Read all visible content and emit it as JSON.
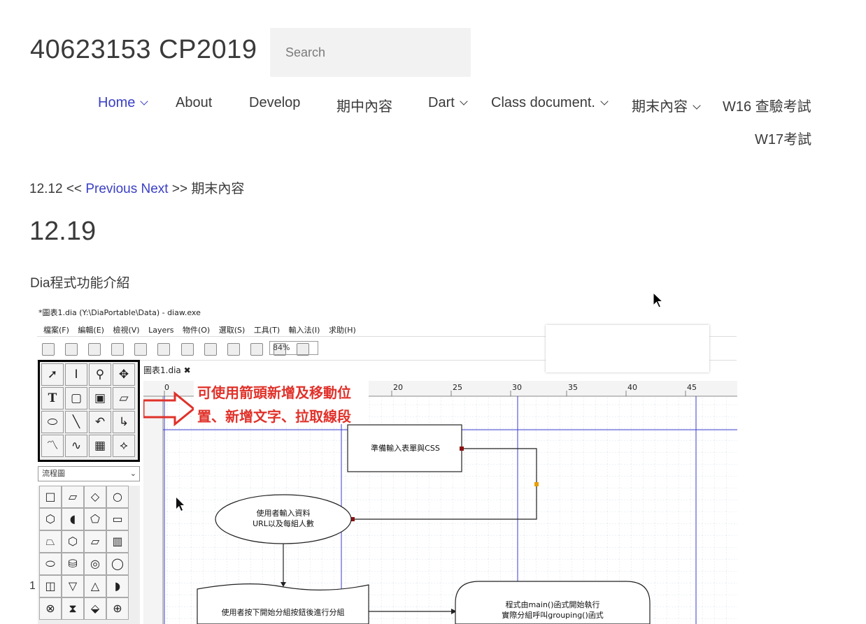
{
  "header": {
    "site_title": "40623153 CP2019",
    "search_placeholder": "Search"
  },
  "nav": [
    {
      "label": "Home",
      "dropdown": true,
      "active": true
    },
    {
      "label": "About",
      "dropdown": false
    },
    {
      "label": "Develop",
      "dropdown": false
    },
    {
      "label": "期中內容",
      "dropdown": false
    },
    {
      "label": "Dart",
      "dropdown": true
    },
    {
      "label": "Class document.",
      "dropdown": true
    },
    {
      "label": "期末內容",
      "dropdown": true
    },
    {
      "label": "W16 查驗考試",
      "dropdown": false
    },
    {
      "label": "W17考試",
      "dropdown": false
    }
  ],
  "breadcrumb": {
    "prefix": "12.12 <<",
    "previous": "Previous",
    "next": "Next",
    "suffix": ">> 期末內容"
  },
  "post": {
    "title": "12.19",
    "intro": "Dia程式功能介紹",
    "list_number": "1."
  },
  "screenshot": {
    "window_title": "*圖表1.dia (Y:\\DiaPortable\\Data) - diaw.exe",
    "menu": [
      "檔案(F)",
      "編輯(E)",
      "檢視(V)",
      "Layers",
      "物件(O)",
      "選取(S)",
      "工具(T)",
      "輸入法(I)",
      "求助(H)"
    ],
    "zoom": "84%",
    "sheet": "流程圖",
    "tab": "圖表1.dia",
    "ruler": [
      "0",
      "20",
      "25",
      "30",
      "35",
      "40",
      "45"
    ],
    "annotation_line1": "可使用箭頭新增及移動位",
    "annotation_line2": "置、新增文字、拉取線段",
    "box1": "準備輸入表單與CSS",
    "ellipse1_line1": "使用者輸入資料",
    "ellipse1_line2": "URL以及每組人數",
    "box2": "使用者按下開始分組按鈕後進行分組",
    "terminal_line1": "程式由main()函式開始執行",
    "terminal_line2": "實際分組呼叫grouping()函式",
    "toolbox_icons": [
      "pointer-tool",
      "text-cursor-tool",
      "magnifier-tool",
      "move-tool",
      "text-tool",
      "box-tool",
      "ellipse-tool",
      "polygon-tool",
      "beziergon-tool",
      "line-tool",
      "arc-tool",
      "zigzag-tool",
      "polyline-tool",
      "bezier-tool",
      "image-tool",
      "outline-tool"
    ],
    "colors": {
      "annotation": "#e0312a",
      "grid_major": "#3b3bd0",
      "grid_minor": "#cfd8e6",
      "connection": "#8b1010",
      "handle": "#e8a000"
    }
  }
}
